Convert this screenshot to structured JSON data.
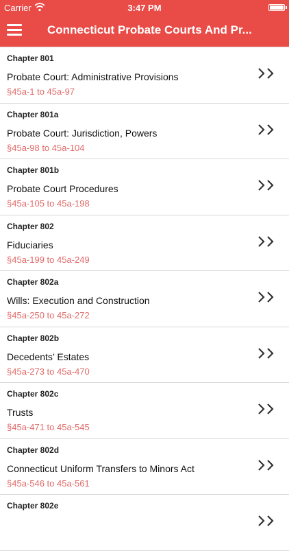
{
  "status_bar": {
    "carrier": "Carrier",
    "time": "3:47 PM"
  },
  "nav": {
    "title": "Connecticut Probate Courts And Pr..."
  },
  "colors": {
    "accent": "#e94b47",
    "range_text": "#e06c6a"
  },
  "icons": {
    "menu": "hamburger-icon",
    "row_action": "double-chevron-right-icon"
  },
  "chapters": [
    {
      "chapter": "Chapter 801",
      "title": "Probate Court: Administrative Provisions",
      "range": "§45a-1 to 45a-97"
    },
    {
      "chapter": "Chapter 801a",
      "title": "Probate Court: Jurisdiction, Powers",
      "range": "§45a-98 to 45a-104"
    },
    {
      "chapter": "Chapter 801b",
      "title": "Probate Court Procedures",
      "range": "§45a-105 to 45a-198"
    },
    {
      "chapter": "Chapter 802",
      "title": "Fiduciaries",
      "range": "§45a-199 to 45a-249"
    },
    {
      "chapter": "Chapter 802a",
      "title": "Wills: Execution and Construction",
      "range": "§45a-250 to 45a-272"
    },
    {
      "chapter": "Chapter 802b",
      "title": "Decedents’ Estates",
      "range": "§45a-273 to 45a-470"
    },
    {
      "chapter": "Chapter 802c",
      "title": "Trusts",
      "range": "§45a-471 to 45a-545"
    },
    {
      "chapter": "Chapter 802d",
      "title": "Connecticut Uniform Transfers to Minors Act",
      "range": "§45a-546 to 45a-561"
    },
    {
      "chapter": "Chapter 802e",
      "title": "",
      "range": ""
    }
  ]
}
